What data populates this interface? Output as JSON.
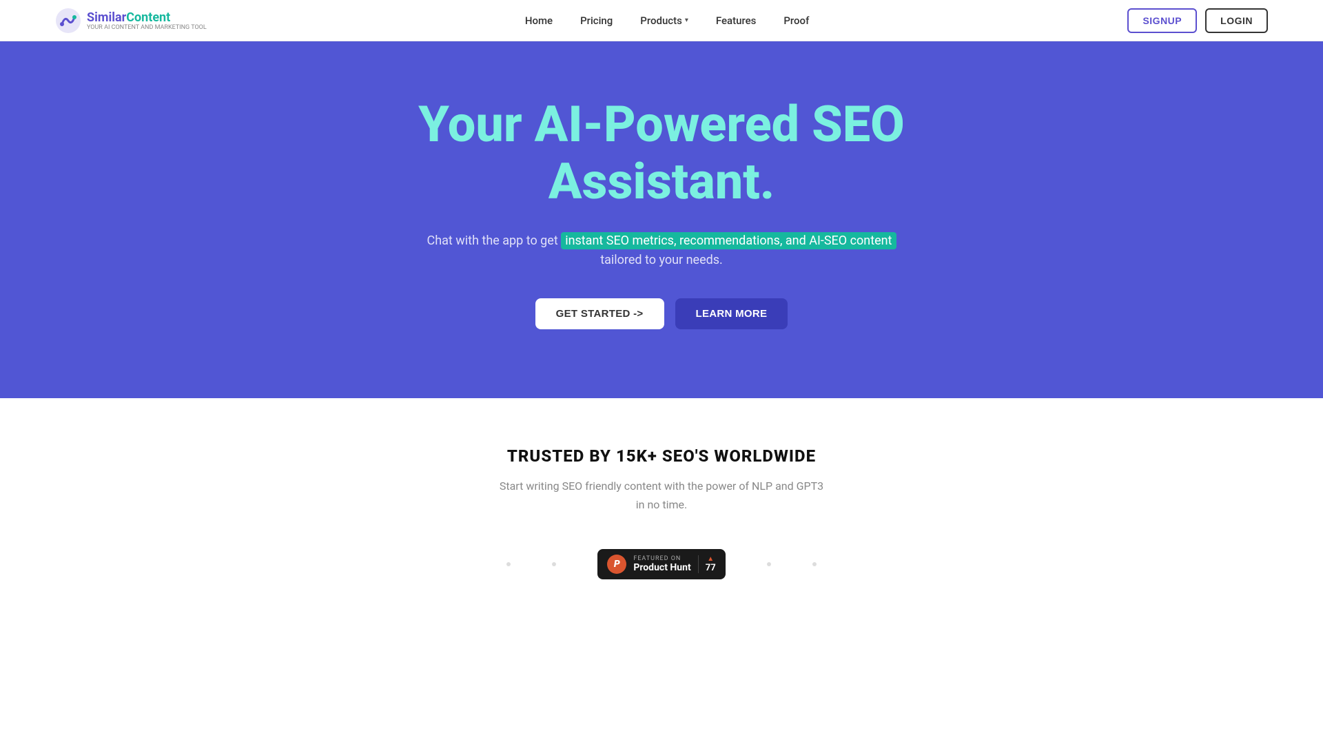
{
  "navbar": {
    "logo": {
      "text_similar": "Similar",
      "text_content": "Content",
      "subtitle": "YOUR AI CONTENT AND MARKETING TOOL"
    },
    "nav_links": [
      {
        "label": "Home",
        "id": "home"
      },
      {
        "label": "Pricing",
        "id": "pricing"
      },
      {
        "label": "Products",
        "id": "products",
        "has_dropdown": true
      },
      {
        "label": "Features",
        "id": "features"
      },
      {
        "label": "Proof",
        "id": "proof"
      }
    ],
    "signup_label": "SIGNUP",
    "login_label": "LOGIN"
  },
  "hero": {
    "title_line1": "Your AI-Powered SEO",
    "title_line2": "Assistant.",
    "subtitle_before": "Chat with the app to get ",
    "subtitle_highlight": "instant SEO metrics, recommendations, and AI-SEO content",
    "subtitle_after": " tailored to your needs.",
    "cta_primary": "GET STARTED ->",
    "cta_secondary": "LEARN MORE"
  },
  "trusted": {
    "title": "TRUSTED BY 15K+ SEO'S WORLDWIDE",
    "subtitle_line1": "Start writing SEO friendly content with the power of NLP and GPT3",
    "subtitle_line2": "in no time.",
    "product_hunt": {
      "featured_label": "FEATURED ON",
      "name": "Product Hunt",
      "votes": "77"
    }
  }
}
